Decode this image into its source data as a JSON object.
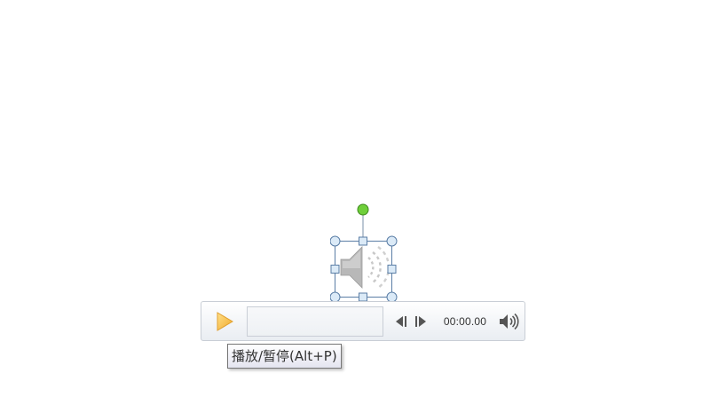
{
  "player": {
    "time": "00:00.00",
    "progress": 0
  },
  "tooltip": {
    "text": "播放/暂停(Alt+P)"
  },
  "icons": {
    "play": "play-icon",
    "seek_back": "seek-back-icon",
    "seek_forward": "seek-forward-icon",
    "volume": "volume-icon",
    "speaker": "speaker-icon",
    "rotate_handle": "rotation-handle"
  },
  "colors": {
    "play_icon": "#f5b73b",
    "rotate_handle": "#6fcf3a",
    "selection": "#5b7ea6",
    "handle_fill": "#dbeaf7"
  }
}
